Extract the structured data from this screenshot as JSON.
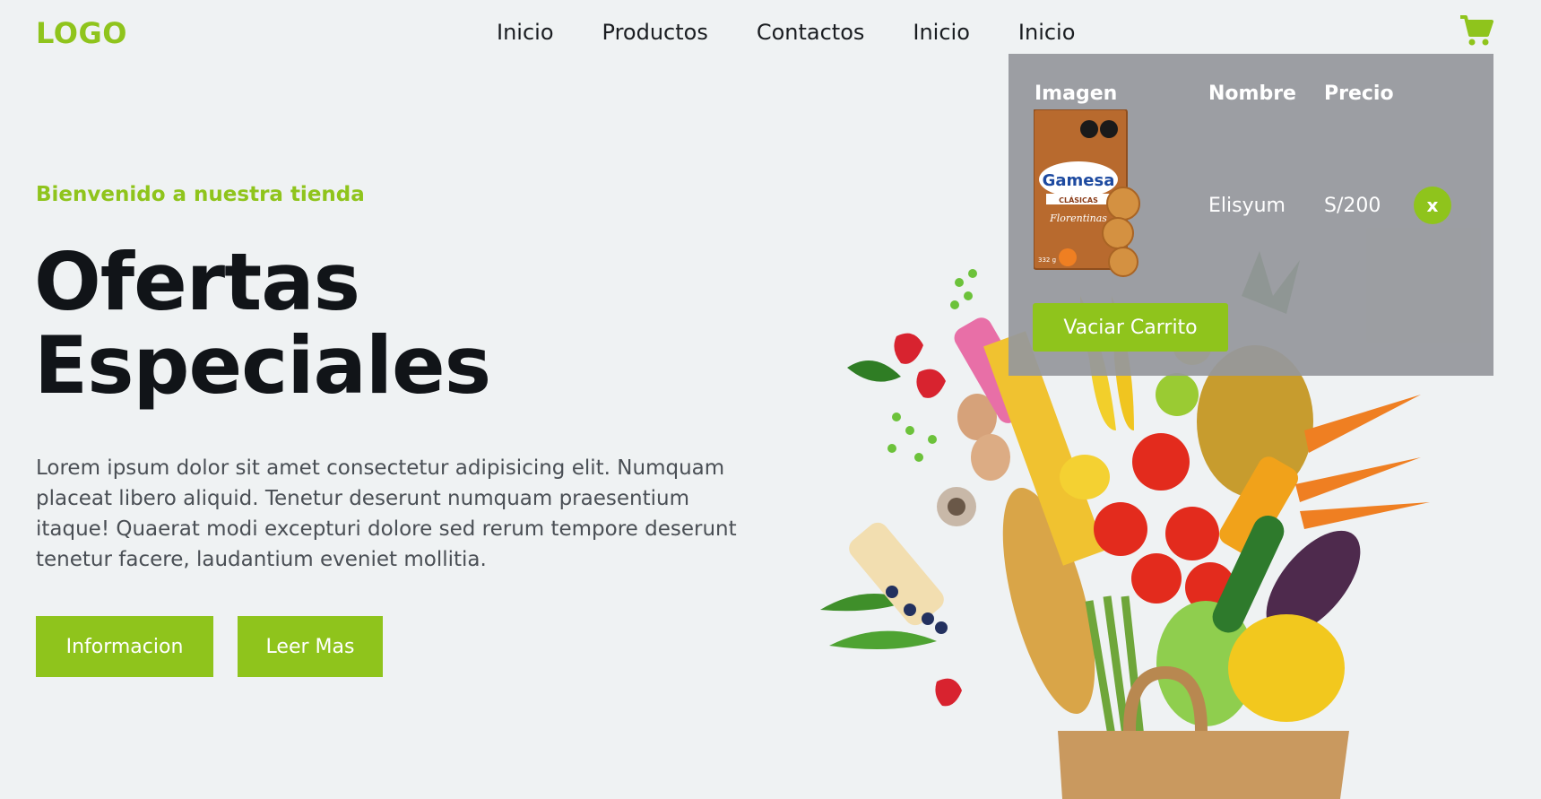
{
  "header": {
    "logo": "LOGO",
    "nav": [
      "Inicio",
      "Productos",
      "Contactos",
      "Inicio",
      "Inicio"
    ],
    "cart_icon": "shopping-cart-icon"
  },
  "hero": {
    "welcome": "Bienvenido a nuestra tienda",
    "title_line1": "Ofertas",
    "title_line2": "Especiales",
    "description": "Lorem ipsum dolor sit amet consectetur adipisicing elit. Numquam placeat libero aliquid. Tenetur deserunt numquam praesentium itaque! Quaerat modi excepturi dolore sed rerum tempore deserunt tenetur facere, laudantium eveniet mollitia.",
    "btn_info": "Informacion",
    "btn_more": "Leer Mas"
  },
  "cart": {
    "headers": {
      "image": "Imagen",
      "name": "Nombre",
      "price": "Precio"
    },
    "items": [
      {
        "brand": "Gamesa",
        "subbrand": "CLÁSICAS",
        "product": "Florentinas",
        "weight": "332 g",
        "name": "Elisyum",
        "price": "S/200",
        "remove": "x"
      }
    ],
    "empty_label": "Vaciar Carrito"
  },
  "colors": {
    "accent": "#8fc41c",
    "background": "#eff2f3",
    "panel": "#96989c"
  }
}
